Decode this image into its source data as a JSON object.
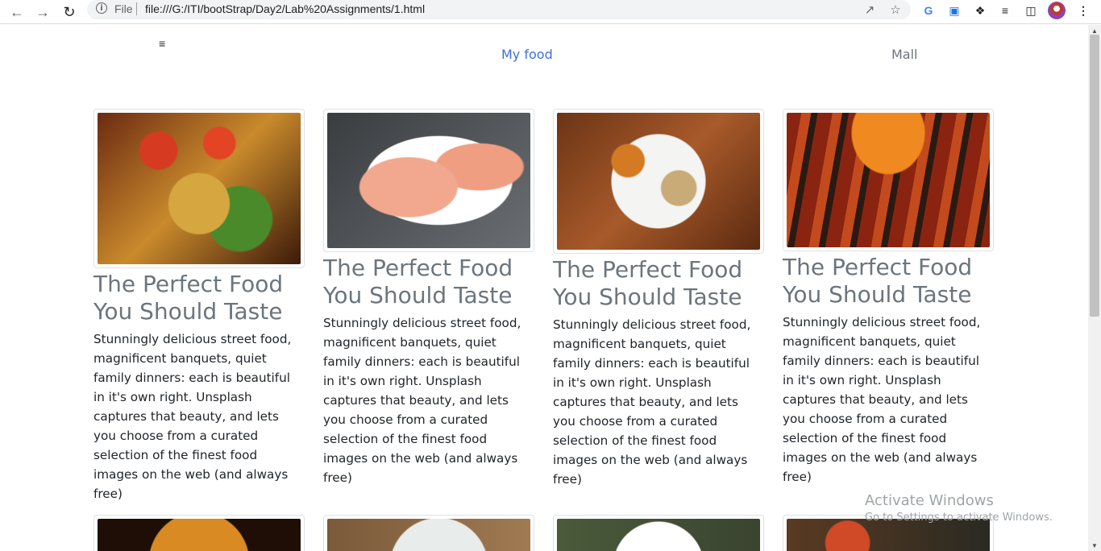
{
  "browser": {
    "file_label": "File",
    "url": "file:///G:/ITI/bootStrap/Day2/Lab%20Assignments/1.html"
  },
  "navbar": {
    "links": [
      {
        "label": "My food",
        "active": true
      },
      {
        "label": "Mall",
        "active": false
      }
    ]
  },
  "cards": [
    {
      "title": "The Perfect Food You Should Taste",
      "text": "Stunningly delicious street food, magnificent banquets, quiet family dinners: each is beautiful in it's own right. Unsplash captures that beauty, and lets you choose from a curated selection of the finest food images on the web (and always free)",
      "image": "dumplings-photo"
    },
    {
      "title": "The Perfect Food You Should Taste",
      "text": "Stunningly delicious street food, magnificent banquets, quiet family dinners: each is beautiful in it's own right. Unsplash captures that beauty, and lets you choose from a curated selection of the finest food images on the web (and always free)",
      "image": "salmon-photo"
    },
    {
      "title": "The Perfect Food You Should Taste",
      "text": "Stunningly delicious street food, magnificent banquets, quiet family dinners: each is beautiful in it's own right. Unsplash captures that beauty, and lets you choose from a curated selection of the finest food images on the web (and always free)",
      "image": "thali-plate-photo"
    },
    {
      "title": "The Perfect Food You Should Taste",
      "text": "Stunningly delicious street food, magnificent banquets, quiet family dinners: each is beautiful in it's own right. Unsplash captures that beauty, and lets you choose from a curated selection of the finest food images on the web (and always free)",
      "image": "skewers-photo"
    }
  ],
  "second_row_images": [
    "burger-photo",
    "salad-bowl-photo",
    "plated-dish-photo",
    "table-spread-photo"
  ],
  "watermark": {
    "title": "Activate Windows",
    "subtitle": "Go to Settings to activate Windows."
  }
}
